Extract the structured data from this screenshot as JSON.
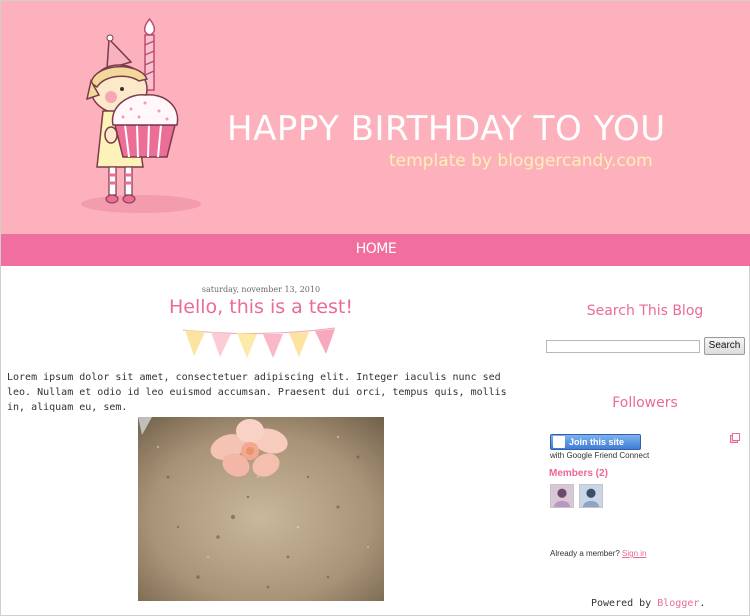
{
  "header": {
    "title": "HAPPY BIRTHDAY TO YOU",
    "subtitle": "template by bloggercandy.com"
  },
  "nav": {
    "items": [
      {
        "label": "HOME"
      }
    ]
  },
  "post": {
    "date": "saturday, november 13, 2010",
    "title": "Hello, this is a test!",
    "body": "Lorem ipsum dolor sit amet, consectetuer adipiscing elit. Integer iaculis nunc sed leo. Nullam et odio id leo euismod accumsan. Praesent dui orci, tempus quis, mollis in, aliquam eu, sem."
  },
  "sidebar": {
    "search": {
      "heading": "Search This Blog",
      "button_label": "Search",
      "placeholder": ""
    },
    "followers": {
      "heading": "Followers",
      "join_label": "Join this site",
      "gfc_label": "with Google Friend Connect",
      "members_label": "Members (2)",
      "already_text": "Already a member?",
      "sign_in_label": "Sign in"
    }
  },
  "footer": {
    "powered_prefix": "Powered by",
    "powered_link": "Blogger",
    "powered_suffix": "."
  },
  "colors": {
    "header_bg": "#fdb1bd",
    "nav_bg": "#f06f9e",
    "accent_pink": "#ea6a9a",
    "subtitle_yellow": "#fdf0b4"
  }
}
